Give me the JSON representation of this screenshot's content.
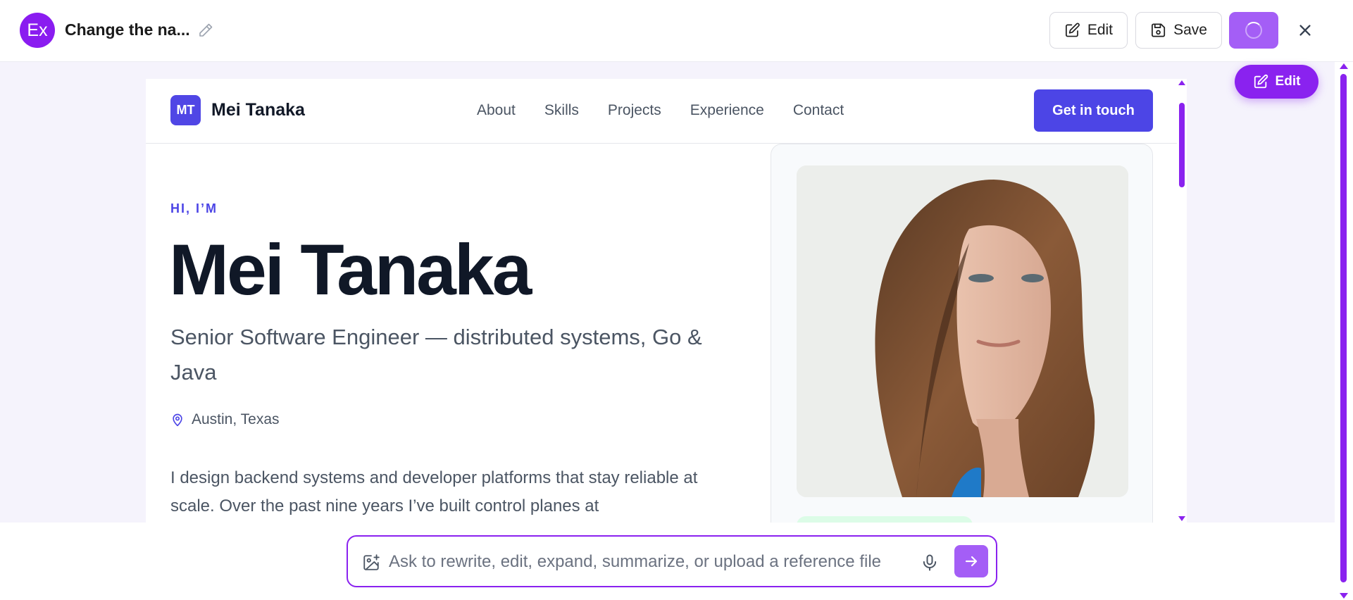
{
  "app": {
    "avatar_initials": "Ex",
    "doc_title": "Change the na...",
    "edit_label": "Edit",
    "save_label": "Save",
    "floating_edit_label": "Edit"
  },
  "site": {
    "logo_initials": "MT",
    "logo_name": "Mei Tanaka",
    "nav": [
      "About",
      "Skills",
      "Projects",
      "Experience",
      "Contact"
    ],
    "cta_label": "Get in touch",
    "eyebrow": "HI, I’M",
    "hero_name": "Mei Tanaka",
    "hero_subtitle": "Senior Software Engineer — distributed systems, Go & Java",
    "location": "Austin, Texas",
    "bio": "I design backend systems and developer platforms that stay reliable at scale. Over the past nine years I’ve built control planes at"
  },
  "prompt": {
    "placeholder": "Ask to rewrite, edit, expand, summarize, or upload a reference file"
  },
  "colors": {
    "brand_purple": "#8a22ef",
    "site_accent": "#4c45e6"
  },
  "icons": {
    "title_edit": "pencil-icon",
    "edit": "square-pencil-icon",
    "save": "floppy-icon",
    "close": "close-icon",
    "location": "map-pin-icon",
    "attach": "image-plus-icon",
    "voice": "microphone-icon",
    "send": "arrow-right-icon"
  }
}
